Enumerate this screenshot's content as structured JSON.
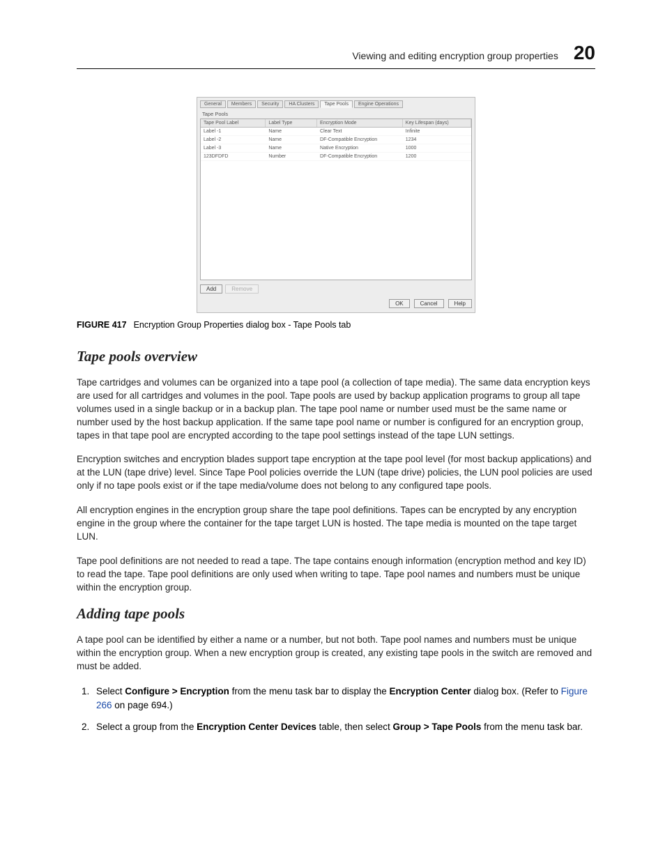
{
  "header": {
    "section_title": "Viewing and editing encryption group properties",
    "chapter_number": "20"
  },
  "dialog": {
    "tabs": [
      "General",
      "Members",
      "Security",
      "HA Clusters",
      "Tape Pools",
      "Engine Operations"
    ],
    "active_tab_index": 4,
    "group_label": "Tape Pools",
    "columns": [
      "Tape Pool Label",
      "Label Type",
      "Encryption Mode",
      "Key Lifespan (days)"
    ],
    "rows": [
      {
        "label": "Label -1",
        "type": "Name",
        "mode": "Clear Text",
        "life": "Infinite"
      },
      {
        "label": "Label -2",
        "type": "Name",
        "mode": "DF-Compatible Encryption",
        "life": "1234"
      },
      {
        "label": "Label -3",
        "type": "Name",
        "mode": "Native Encryption",
        "life": "1000"
      },
      {
        "label": "123DFDFD",
        "type": "Number",
        "mode": "DF-Compatible Encryption",
        "life": "1200"
      }
    ],
    "buttons": {
      "add": "Add",
      "remove": "Remove",
      "ok": "OK",
      "cancel": "Cancel",
      "help": "Help"
    }
  },
  "figure_caption": {
    "label": "FIGURE 417",
    "text": "Encryption Group Properties dialog box - Tape Pools tab"
  },
  "section1": {
    "heading": "Tape pools overview",
    "p1": "Tape cartridges and volumes can be organized into a tape pool (a collection of tape media). The same data encryption keys are used for all cartridges and volumes in the pool. Tape pools are used by backup application programs to group all tape volumes used in a single backup or in a backup plan. The tape pool name or number used must be the same name or number used by the host backup application. If the same tape pool name or number is configured for an encryption group, tapes in that tape pool are encrypted according to the tape pool settings instead of the tape LUN settings.",
    "p2": "Encryption switches and encryption blades support tape encryption at the tape pool level (for most backup applications) and at the LUN (tape drive) level. Since Tape Pool policies override the LUN (tape drive) policies, the LUN pool policies are used only if no tape pools exist or if the tape media/volume does not belong to any configured tape pools.",
    "p3": "All encryption engines in the encryption group share the tape pool definitions. Tapes can be encrypted by any encryption engine in the group where the container for the tape target LUN is hosted. The tape media is mounted on the tape target LUN.",
    "p4": "Tape pool definitions are not needed to read a tape. The tape contains enough information (encryption method and key ID) to read the tape. Tape pool definitions are only used when writing to tape. Tape pool names and numbers must be unique within the encryption group."
  },
  "section2": {
    "heading": "Adding tape pools",
    "p1": "A tape pool can be identified by either a name or a number, but not both. Tape pool names and numbers must be unique within the encryption group. When a new encryption group is created, any existing tape pools in the switch are removed and must be added.",
    "step1": {
      "prefix": "Select ",
      "bold1": "Configure > Encryption",
      "mid": " from the menu task bar to display the ",
      "bold2": "Encryption Center",
      "suffix1": " dialog box. (Refer to ",
      "link": "Figure 266",
      "suffix2": " on page 694.)"
    },
    "step2": {
      "prefix": "Select a group from the ",
      "bold1": "Encryption Center Devices",
      "mid": " table, then select ",
      "bold2": "Group > Tape Pools",
      "suffix": " from the menu task bar."
    }
  }
}
